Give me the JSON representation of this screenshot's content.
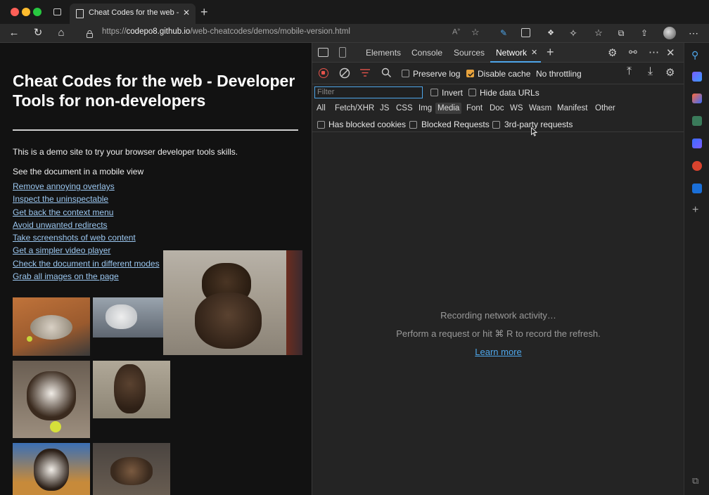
{
  "browser": {
    "tab_title": "Cheat Codes for the web - Dev",
    "url_protocol": "https://",
    "url_host": "codepo8.github.io",
    "url_path": "/web-cheatcodes/demos/mobile-version.html"
  },
  "page": {
    "heading": "Cheat Codes for the web - Developer Tools for non-developers",
    "intro": "This is a demo site to try your browser developer tools skills.",
    "mobile_text": "See the document in a mobile view",
    "links": [
      "Remove annoying overlays",
      "Inspect the uninspectable",
      "Get back the context menu",
      "Avoid unwanted redirects",
      "Take screenshots of web content",
      "Get a simpler video player",
      "Check the document in different modes",
      "Grab all images on the page"
    ]
  },
  "devtools": {
    "tabs": [
      "Elements",
      "Console",
      "Sources",
      "Network"
    ],
    "active_tab": "Network",
    "toolbar": {
      "preserve_log": "Preserve log",
      "disable_cache": "Disable cache",
      "throttling": "No throttling"
    },
    "filter": {
      "placeholder": "Filter",
      "invert": "Invert",
      "hide_data_urls": "Hide data URLs",
      "types": [
        "All",
        "Fetch/XHR",
        "JS",
        "CSS",
        "Img",
        "Media",
        "Font",
        "Doc",
        "WS",
        "Wasm",
        "Manifest",
        "Other"
      ],
      "selected_type": "Media",
      "has_blocked_cookies": "Has blocked cookies",
      "blocked_requests": "Blocked Requests",
      "third_party": "3rd-party requests"
    },
    "empty": {
      "recording": "Recording network activity…",
      "hint": "Perform a request or hit ⌘ R to record the refresh.",
      "learn_more": "Learn more"
    }
  },
  "colors": {
    "accent": "#4ea6ea",
    "link": "#9bc7f0",
    "record": "#e5534b",
    "checkbox_on": "#e8a33d"
  }
}
